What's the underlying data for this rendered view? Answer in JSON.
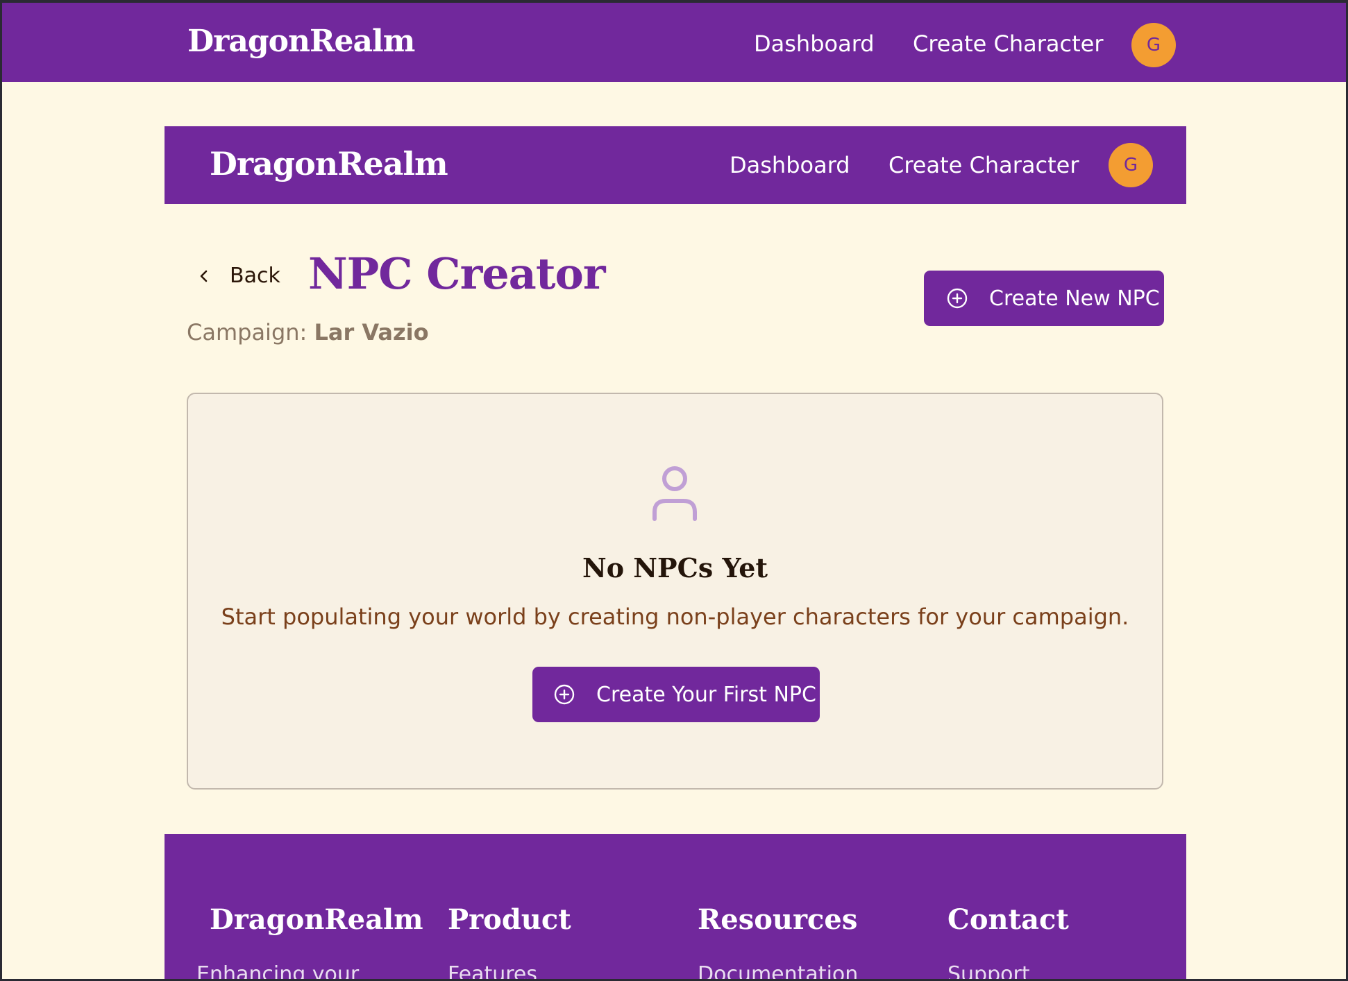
{
  "outer_nav": {
    "brand": "DragonRealm",
    "links": [
      "Dashboard",
      "Create Character"
    ],
    "avatar_initial": "G"
  },
  "inner_nav": {
    "brand": "DragonRealm",
    "links": [
      "Dashboard",
      "Create Character"
    ],
    "avatar_initial": "G"
  },
  "header": {
    "back_label": "Back",
    "title": "NPC Creator",
    "campaign_label": "Campaign:",
    "campaign_name": "Lar Vazio",
    "create_button": "Create New NPC"
  },
  "empty_state": {
    "icon": "user-icon",
    "title": "No NPCs Yet",
    "description": "Start populating your world by creating non-player characters for your campaign.",
    "button": "Create Your First NPC"
  },
  "footer": {
    "columns": [
      {
        "heading": "DragonRealm",
        "first_line": "Enhancing your"
      },
      {
        "heading": "Product",
        "first_line": "Features"
      },
      {
        "heading": "Resources",
        "first_line": "Documentation"
      },
      {
        "heading": "Contact",
        "first_line": "Support"
      }
    ]
  },
  "colors": {
    "primary": "#71289c",
    "background": "#fef8e4",
    "avatar": "#f39d32",
    "card_background": "#f8f1e4",
    "description_text": "#7a401b"
  }
}
